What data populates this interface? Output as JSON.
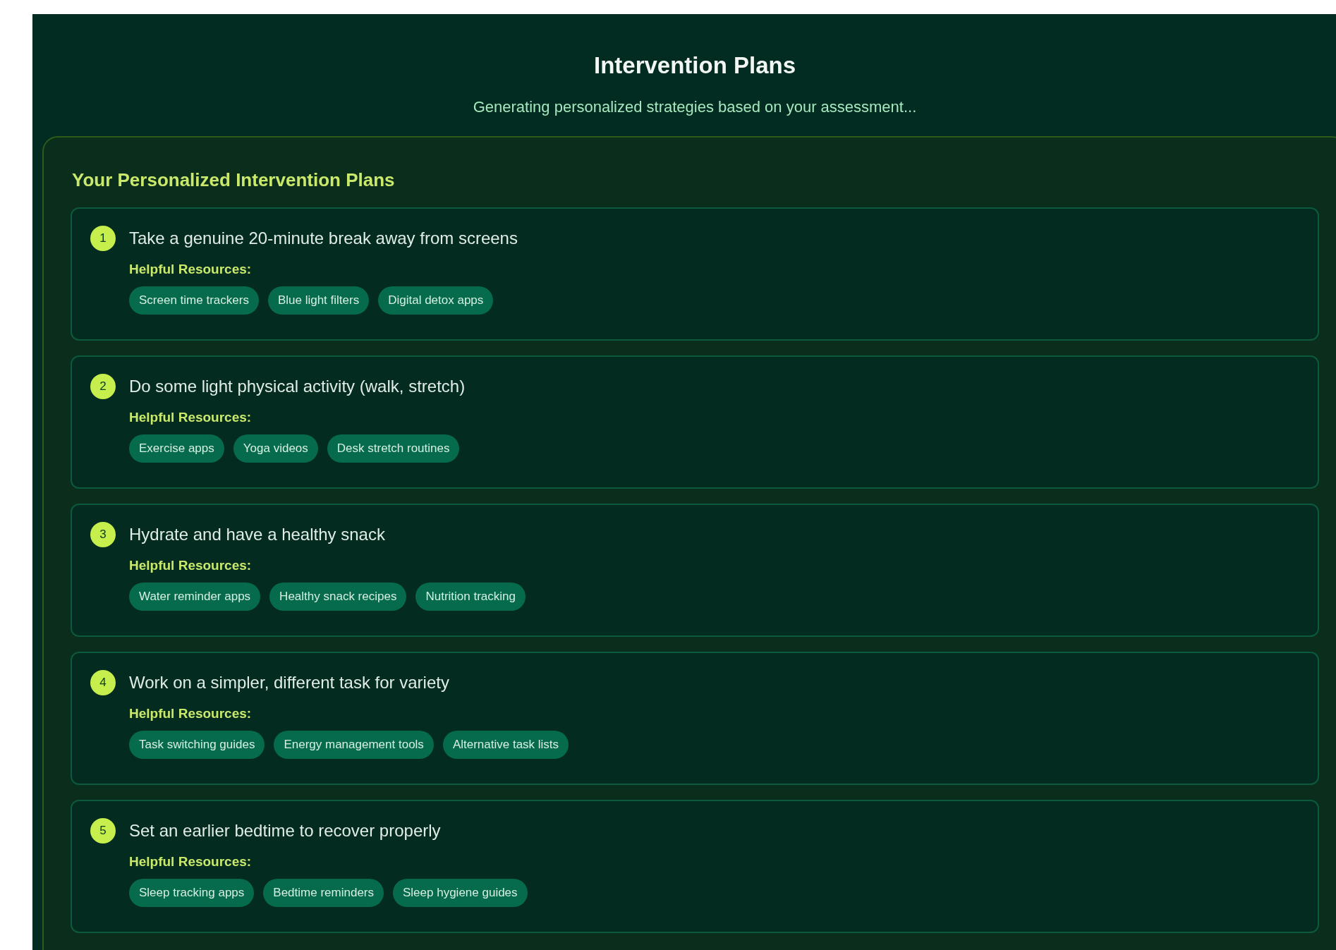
{
  "header": {
    "title": "Intervention Plans",
    "subtitle": "Generating personalized strategies based on your assessment..."
  },
  "plans_card": {
    "heading": "Your Personalized Intervention Plans",
    "plans": [
      {
        "number": "1",
        "title": "Take a genuine 20-minute break away from screens",
        "resources_label": "Helpful Resources:",
        "resources": [
          "Screen time trackers",
          "Blue light filters",
          "Digital detox apps"
        ]
      },
      {
        "number": "2",
        "title": "Do some light physical activity (walk, stretch)",
        "resources_label": "Helpful Resources:",
        "resources": [
          "Exercise apps",
          "Yoga videos",
          "Desk stretch routines"
        ]
      },
      {
        "number": "3",
        "title": "Hydrate and have a healthy snack",
        "resources_label": "Helpful Resources:",
        "resources": [
          "Water reminder apps",
          "Healthy snack recipes",
          "Nutrition tracking"
        ]
      },
      {
        "number": "4",
        "title": "Work on a simpler, different task for variety",
        "resources_label": "Helpful Resources:",
        "resources": [
          "Task switching guides",
          "Energy management tools",
          "Alternative task lists"
        ]
      },
      {
        "number": "5",
        "title": "Set an earlier bedtime to recover properly",
        "resources_label": "Helpful Resources:",
        "resources": [
          "Sleep tracking apps",
          "Bedtime reminders",
          "Sleep hygiene guides"
        ]
      }
    ]
  }
}
